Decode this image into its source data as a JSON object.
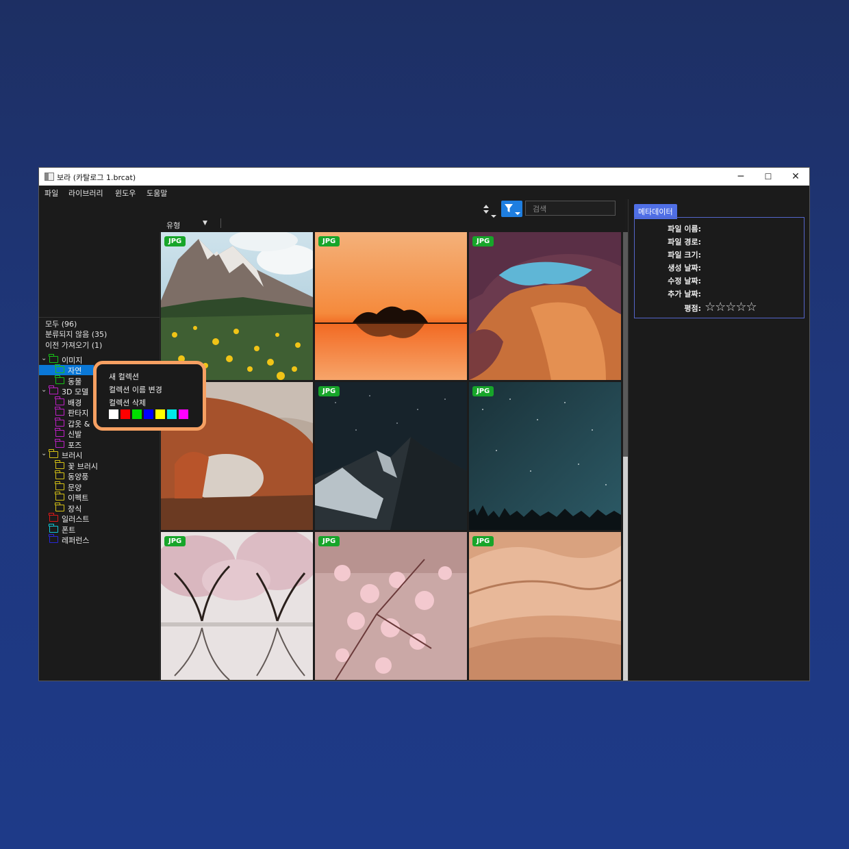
{
  "window": {
    "title": "보라 (카탈로그 1.brcat)",
    "minimize": "─",
    "maximize": "☐",
    "close": "✕"
  },
  "menu": [
    "파일",
    "라이브러리",
    "윈도우",
    "도움말"
  ],
  "sidebar": {
    "filters": [
      "모두 (96)",
      "분류되지 않음 (35)",
      "이전 가져오기 (1)"
    ],
    "tree": [
      {
        "label": "이미지",
        "color": "#16c416",
        "expanded": true
      },
      {
        "label": "자연",
        "color": "#16c416",
        "selected": true
      },
      {
        "label": "동물",
        "color": "#16c416"
      },
      {
        "label": "3D 모델",
        "color": "#c020c8",
        "expanded": true
      },
      {
        "label": "배경",
        "color": "#c020c8"
      },
      {
        "label": "판타지",
        "color": "#c020c8"
      },
      {
        "label": "갑옷 &",
        "color": "#c020c8"
      },
      {
        "label": "신발",
        "color": "#c020c8"
      },
      {
        "label": "포즈",
        "color": "#c020c8"
      },
      {
        "label": "브러시",
        "color": "#d8c414",
        "expanded": true
      },
      {
        "label": "꽃 브러시",
        "color": "#d8c414"
      },
      {
        "label": "동양풍",
        "color": "#d8c414"
      },
      {
        "label": "문양",
        "color": "#d8c414"
      },
      {
        "label": "이펙트",
        "color": "#d8c414"
      },
      {
        "label": "장식",
        "color": "#d8c414"
      },
      {
        "label": "일러스트",
        "color": "#e01818"
      },
      {
        "label": "폰트",
        "color": "#10c8d8"
      },
      {
        "label": "레퍼런스",
        "color": "#2828d8"
      }
    ]
  },
  "toolbar": {
    "search_placeholder": "검색",
    "type_label": "유형"
  },
  "tiles": [
    {
      "badge": "JPG",
      "scene": "mountain-flowers"
    },
    {
      "badge": "JPG",
      "scene": "sunset-lake"
    },
    {
      "badge": "JPG",
      "scene": "canyon"
    },
    {
      "badge": "",
      "scene": "rock-arch"
    },
    {
      "badge": "JPG",
      "scene": "night-mountain"
    },
    {
      "badge": "JPG",
      "scene": "starry-sky"
    },
    {
      "badge": "JPG",
      "scene": "cherry-trees"
    },
    {
      "badge": "JPG",
      "scene": "blossom"
    },
    {
      "badge": "JPG",
      "scene": "desert"
    }
  ],
  "metadata": {
    "tab": "메타데이터",
    "fields": [
      "파일 이름:",
      "파일 경로:",
      "파일 크기:",
      "생성 날짜:",
      "수정 날짜:",
      "추가 날짜:"
    ],
    "rating_label": "평점:",
    "rating": 0,
    "rating_max": 5
  },
  "context_menu": {
    "items": [
      "새 컬렉션",
      "컬렉션 이름 변경",
      "컬렉션 삭제"
    ],
    "colors": [
      "#ffffff",
      "#ff0000",
      "#00e000",
      "#0000ff",
      "#ffff00",
      "#00e8e8",
      "#ff00ff"
    ]
  }
}
